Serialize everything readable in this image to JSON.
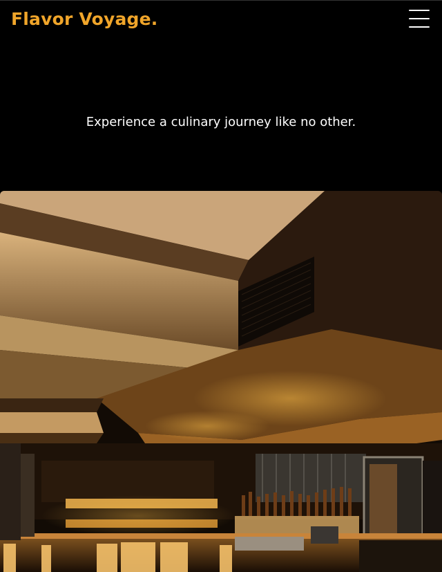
{
  "header": {
    "brand": "Flavor Voyage.",
    "menu_icon": "hamburger-menu-icon"
  },
  "hero": {
    "tagline": "Experience a culinary journey like no other.",
    "image": "restaurant-bar-interior-photo"
  },
  "colors": {
    "background": "#000000",
    "brand_accent": "#f0a52a",
    "text": "#ffffff"
  }
}
